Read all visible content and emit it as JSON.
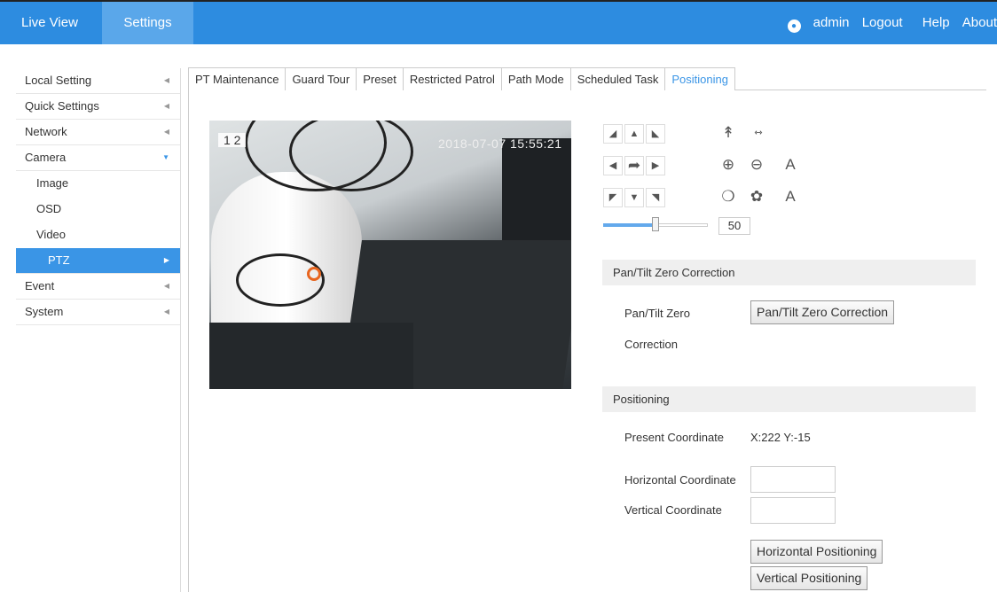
{
  "header": {
    "live_view": "Live View",
    "settings": "Settings",
    "user": "admin",
    "logout": "Logout",
    "help": "Help",
    "about": "About"
  },
  "sidebar": {
    "items": [
      {
        "label": "Local Setting"
      },
      {
        "label": "Quick Settings"
      },
      {
        "label": "Network"
      },
      {
        "label": "Camera"
      },
      {
        "label": "Image"
      },
      {
        "label": "OSD"
      },
      {
        "label": "Video"
      },
      {
        "label": "PTZ"
      },
      {
        "label": "Event"
      },
      {
        "label": "System"
      }
    ]
  },
  "tabs": [
    {
      "label": "PT Maintenance"
    },
    {
      "label": "Guard Tour"
    },
    {
      "label": "Preset"
    },
    {
      "label": "Restricted Patrol"
    },
    {
      "label": "Path Mode"
    },
    {
      "label": "Scheduled Task"
    },
    {
      "label": "Positioning"
    }
  ],
  "video": {
    "channel": "1 2",
    "osd_time": "2018-07-07 15:55:21"
  },
  "ptz": {
    "speed": "50",
    "speed_level": 0.5,
    "focus_auto": "A",
    "iris_auto": "A"
  },
  "zero_correction": {
    "header": "Pan/Tilt Zero Correction",
    "label_line1": "Pan/Tilt Zero",
    "label_line2": "Correction",
    "button": "Pan/Tilt Zero Correction"
  },
  "positioning": {
    "header": "Positioning",
    "present_label": "Present Coordinate",
    "present_value": "X:222 Y:-15",
    "horizontal_label": "Horizontal Coordinate",
    "horizontal_value": "",
    "vertical_label": "Vertical Coordinate",
    "vertical_value": "",
    "horizontal_button": "Horizontal Positioning",
    "vertical_button": "Vertical Positioning"
  }
}
